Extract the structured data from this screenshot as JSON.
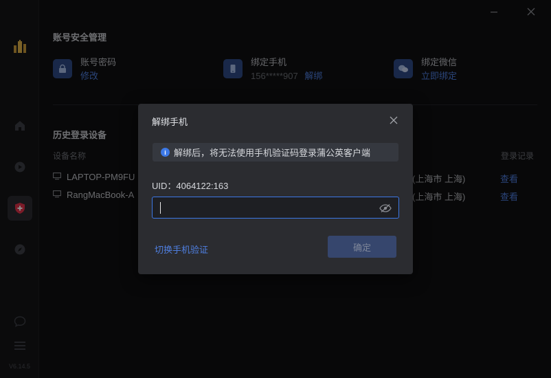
{
  "app": {
    "version": "V6.14.5"
  },
  "account": {
    "section_title": "账号安全管理",
    "password": {
      "label": "账号密码",
      "action": "修改"
    },
    "phone": {
      "label": "绑定手机",
      "value": "156*****907",
      "action": "解绑"
    },
    "wechat": {
      "label": "绑定微信",
      "action": "立即绑定"
    }
  },
  "devices": {
    "section_title": "历史登录设备",
    "columns": {
      "name": "设备名称",
      "record": "登录记录"
    },
    "rows": [
      {
        "name": "LAPTOP-PM9FU",
        "location": "(上海市 上海)",
        "action": "查看"
      },
      {
        "name": "RangMacBook-A",
        "location": "(上海市 上海)",
        "action": "查看"
      }
    ]
  },
  "dialog": {
    "title": "解绑手机",
    "notice": "解绑后，将无法使用手机验证码登录蒲公英客户端",
    "uid_label": "UID：4064122:163",
    "password_value": "",
    "switch_label": "切换手机验证",
    "confirm_label": "确定"
  },
  "colors": {
    "accent": "#4f7fe0",
    "icon_bg": "#2e4a86",
    "danger": "#e0324a"
  }
}
